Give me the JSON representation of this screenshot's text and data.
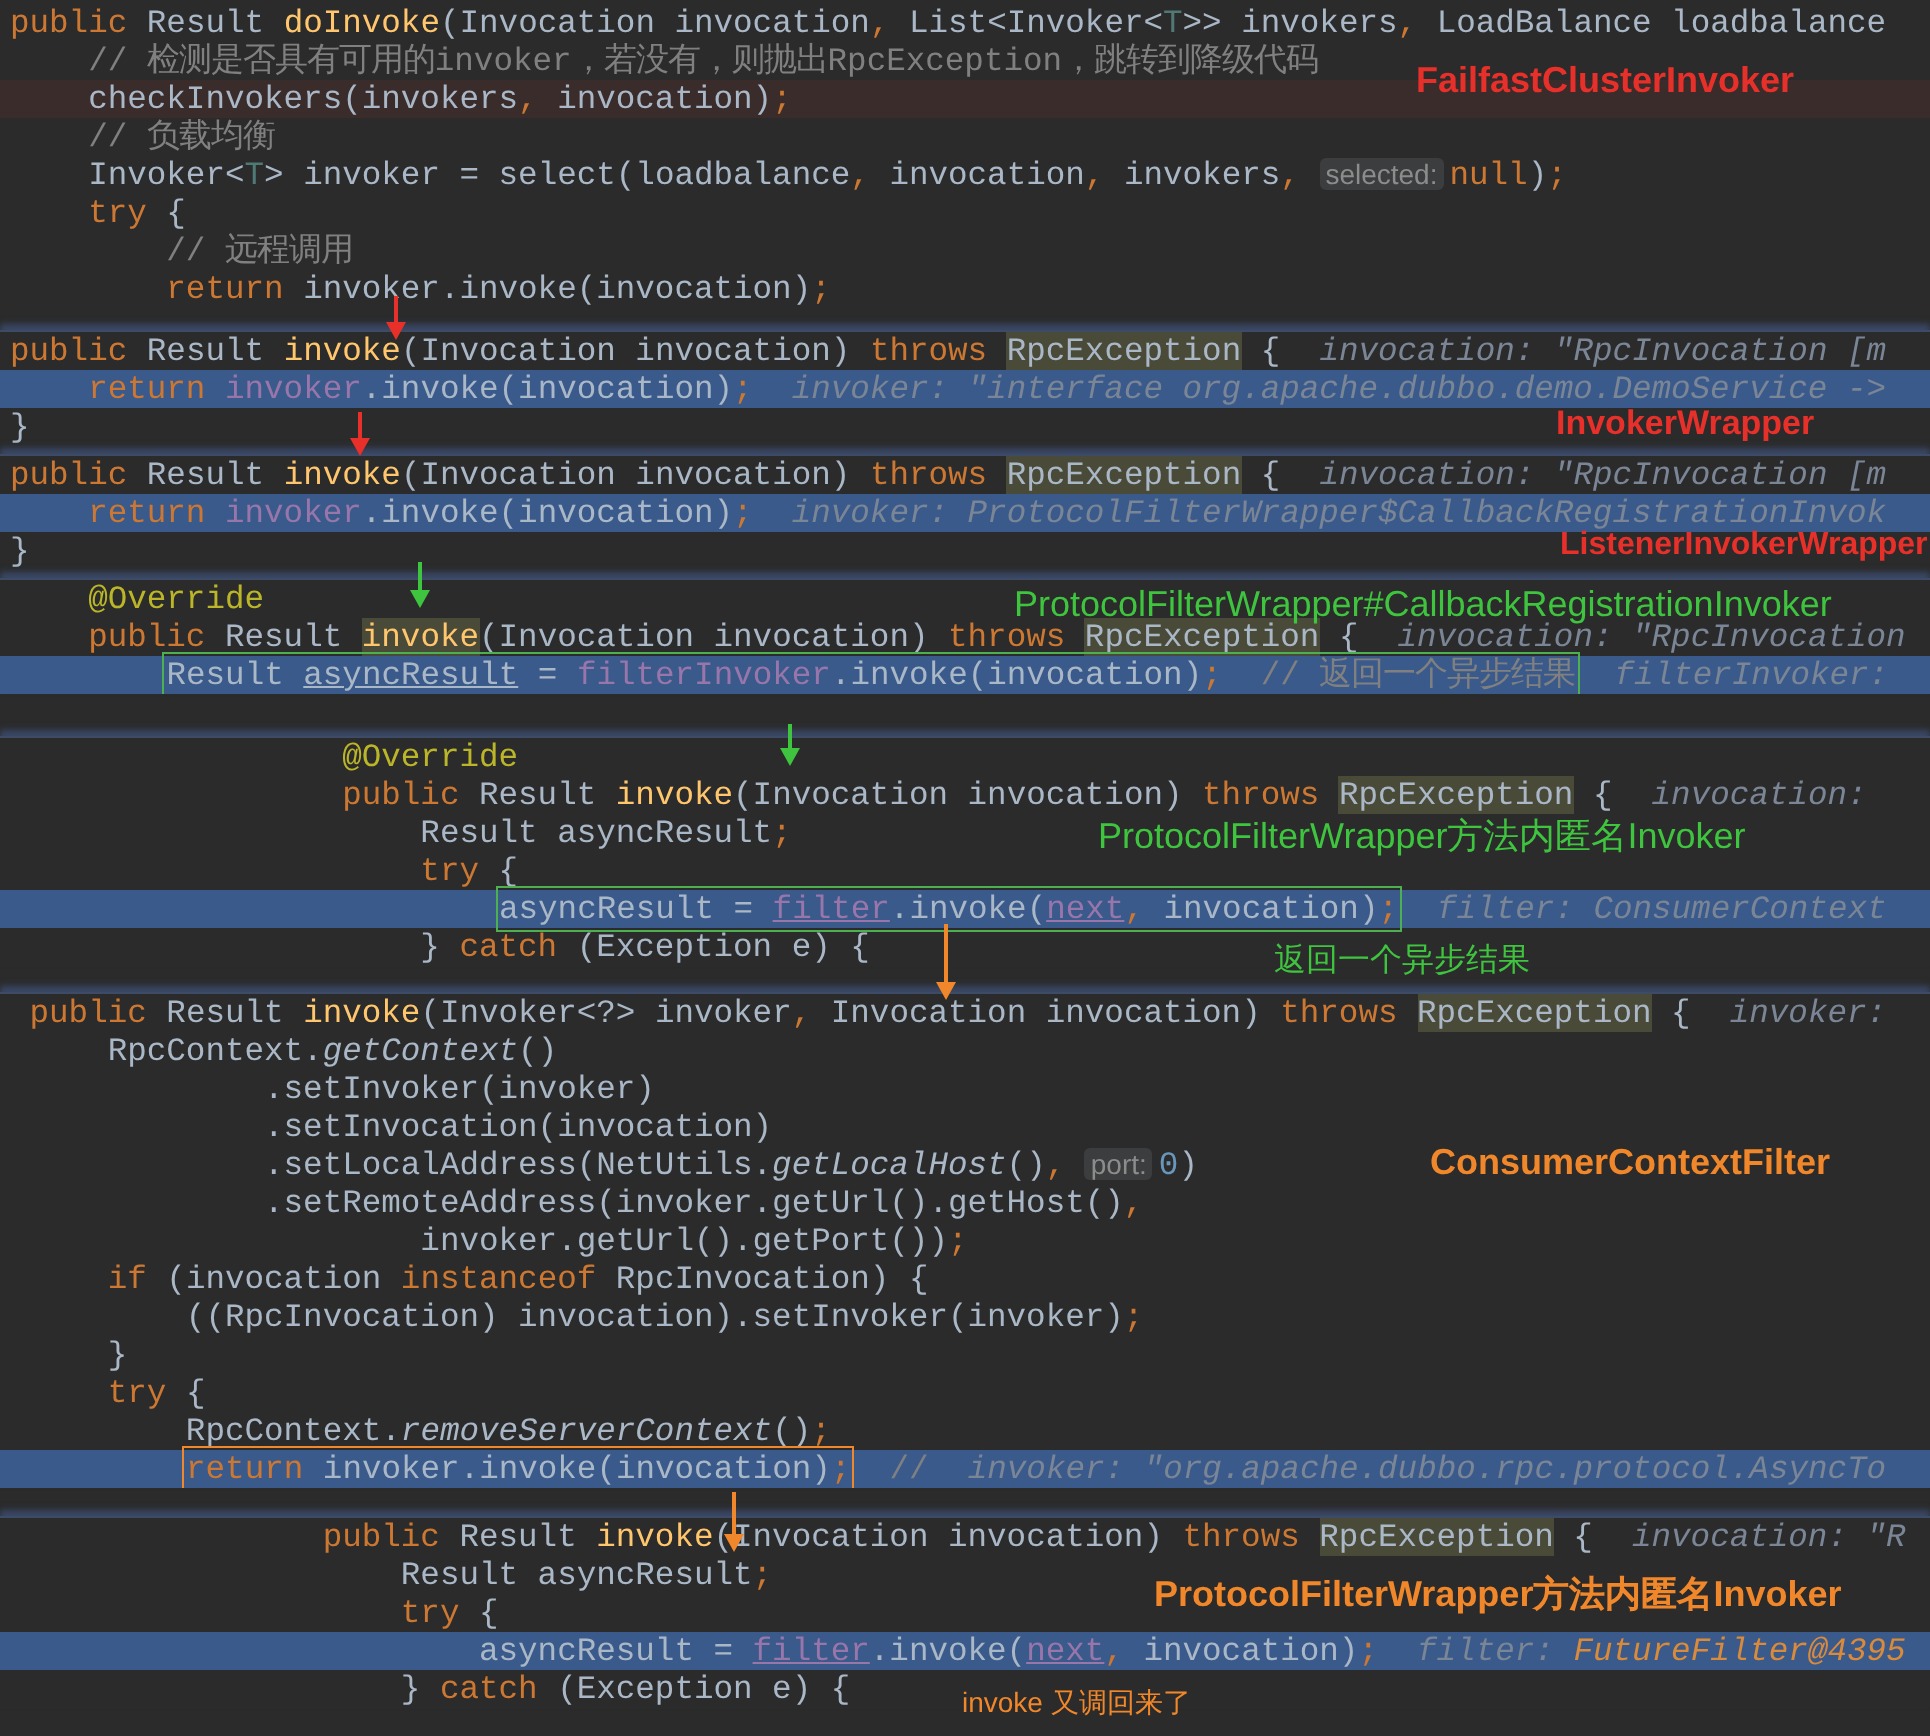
{
  "panels": [
    {
      "lines": [
        {
          "tokens": [
            {
              "kind": "keyword",
              "text": "public "
            },
            {
              "kind": "plain",
              "text": "Result "
            },
            {
              "kind": "method",
              "text": "doInvoke"
            },
            {
              "kind": "plain",
              "text": "(Invocation invocation"
            },
            {
              "kind": "keyword",
              "text": ", "
            },
            {
              "kind": "plain",
              "text": "List<Invoker<"
            },
            {
              "kind": "type",
              "text": "T"
            },
            {
              "kind": "plain",
              "text": ">> invokers"
            },
            {
              "kind": "keyword",
              "text": ", "
            },
            {
              "kind": "plain",
              "text": "LoadBalance loadbalance"
            }
          ]
        },
        {
          "tokens": [
            {
              "kind": "comment",
              "text": "    // 检测是否具有可用的invoker，若没有，则抛出RpcException，跳转到降级代码"
            }
          ]
        },
        {
          "breakpoint": true,
          "tokens": [
            {
              "kind": "plain",
              "text": "    checkInvokers(invokers"
            },
            {
              "kind": "keyword",
              "text": ", "
            },
            {
              "kind": "plain",
              "text": "invocation)"
            },
            {
              "kind": "keyword",
              "text": ";"
            }
          ]
        },
        {
          "tokens": [
            {
              "kind": "comment",
              "text": "    // 负载均衡"
            }
          ]
        },
        {
          "tokens": [
            {
              "kind": "plain",
              "text": "    Invoker<"
            },
            {
              "kind": "type",
              "text": "T"
            },
            {
              "kind": "plain",
              "text": "> invoker = select(loadbalance"
            },
            {
              "kind": "keyword",
              "text": ", "
            },
            {
              "kind": "plain",
              "text": "invocation"
            },
            {
              "kind": "keyword",
              "text": ", "
            },
            {
              "kind": "plain",
              "text": "invokers"
            },
            {
              "kind": "keyword",
              "text": ", "
            },
            {
              "kind": "chip",
              "text": "selected:"
            },
            {
              "kind": "keyword",
              "text": "null"
            },
            {
              "kind": "plain",
              "text": ")"
            },
            {
              "kind": "keyword",
              "text": ";"
            }
          ]
        },
        {
          "tokens": [
            {
              "kind": "keyword",
              "text": "    try "
            },
            {
              "kind": "plain",
              "text": "{"
            }
          ]
        },
        {
          "tokens": [
            {
              "kind": "comment",
              "text": "        // 远程调用"
            }
          ]
        },
        {
          "tokens": [
            {
              "kind": "keyword",
              "text": "        return "
            },
            {
              "kind": "plain",
              "text": "invoker.invoke(invocation)"
            },
            {
              "kind": "keyword",
              "text": ";"
            }
          ]
        }
      ]
    },
    {
      "lines": [
        {
          "tokens": [
            {
              "kind": "keyword",
              "text": "public "
            },
            {
              "kind": "plain",
              "text": "Result "
            },
            {
              "kind": "method",
              "text": "invoke"
            },
            {
              "kind": "plain",
              "text": "(Invocation invocation) "
            },
            {
              "kind": "keyword",
              "text": "throws "
            },
            {
              "kind": "exception",
              "text": "RpcException"
            },
            {
              "kind": "plain",
              "text": " {  "
            },
            {
              "kind": "hint",
              "text": "invocation: \"RpcInvocation [m"
            }
          ]
        },
        {
          "highlighted": true,
          "tokens": [
            {
              "kind": "keyword",
              "text": "    return "
            },
            {
              "kind": "field",
              "text": "invoker"
            },
            {
              "kind": "plain",
              "text": ".invoke(invocation)"
            },
            {
              "kind": "keyword",
              "text": ";"
            },
            {
              "kind": "hint",
              "text": "  invoker: \"interface org.apache.dubbo.demo.DemoService ->"
            }
          ]
        },
        {
          "tokens": [
            {
              "kind": "plain",
              "text": "}"
            }
          ]
        }
      ]
    },
    {
      "lines": [
        {
          "tokens": [
            {
              "kind": "keyword",
              "text": "public "
            },
            {
              "kind": "plain",
              "text": "Result "
            },
            {
              "kind": "method",
              "text": "invoke"
            },
            {
              "kind": "plain",
              "text": "(Invocation invocation) "
            },
            {
              "kind": "keyword",
              "text": "throws "
            },
            {
              "kind": "exception",
              "text": "RpcException"
            },
            {
              "kind": "plain",
              "text": " {  "
            },
            {
              "kind": "hint",
              "text": "invocation: \"RpcInvocation [m"
            }
          ]
        },
        {
          "highlighted": true,
          "tokens": [
            {
              "kind": "keyword",
              "text": "    return "
            },
            {
              "kind": "field",
              "text": "invoker"
            },
            {
              "kind": "plain",
              "text": ".invoke(invocation)"
            },
            {
              "kind": "keyword",
              "text": ";"
            },
            {
              "kind": "hint",
              "text": "  invoker: ProtocolFilterWrapper$CallbackRegistrationInvok"
            }
          ]
        },
        {
          "tokens": [
            {
              "kind": "plain",
              "text": "}"
            }
          ]
        }
      ]
    },
    {
      "lines": [
        {
          "tokens": [
            {
              "kind": "annotation",
              "text": "    @Override"
            }
          ]
        },
        {
          "tokens": [
            {
              "kind": "keyword",
              "text": "    public "
            },
            {
              "kind": "plain",
              "text": "Result "
            },
            {
              "kind": "usage",
              "text": "invoke"
            },
            {
              "kind": "plain",
              "text": "(Invocation invocation) "
            },
            {
              "kind": "keyword",
              "text": "throws "
            },
            {
              "kind": "exception",
              "text": "RpcException"
            },
            {
              "kind": "plain",
              "text": " {  "
            },
            {
              "kind": "hint",
              "text": "invocation: \"RpcInvocation"
            }
          ]
        },
        {
          "highlighted": true,
          "tokens": [
            {
              "kind": "box",
              "color": "#4caf50",
              "tokens": [
                {
                  "kind": "plain",
                  "text": "Result "
                },
                {
                  "kind": "underlined",
                  "text": "asyncResult"
                },
                {
                  "kind": "plain",
                  "text": " = "
                },
                {
                  "kind": "field",
                  "text": "filterInvoker"
                },
                {
                  "kind": "plain",
                  "text": ".invoke(invocation)"
                },
                {
                  "kind": "keyword",
                  "text": ";"
                },
                {
                  "kind": "comment",
                  "text": "  // 返回一个异步结果"
                }
              ]
            },
            {
              "kind": "hint",
              "text": "  filterInvoker:"
            }
          ]
        }
      ]
    },
    {
      "lines": [
        {
          "tokens": [
            {
              "kind": "annotation",
              "text": "                 @Override"
            }
          ]
        },
        {
          "tokens": [
            {
              "kind": "keyword",
              "text": "                 public "
            },
            {
              "kind": "plain",
              "text": "Result "
            },
            {
              "kind": "method",
              "text": "invoke"
            },
            {
              "kind": "plain",
              "text": "(Invocation invocation) "
            },
            {
              "kind": "keyword",
              "text": "throws "
            },
            {
              "kind": "exception",
              "text": "RpcException"
            },
            {
              "kind": "plain",
              "text": " {  "
            },
            {
              "kind": "hint",
              "text": "invocation:"
            }
          ]
        },
        {
          "tokens": [
            {
              "kind": "plain",
              "text": "                     Result asyncResult"
            },
            {
              "kind": "keyword",
              "text": ";"
            }
          ]
        },
        {
          "tokens": [
            {
              "kind": "keyword",
              "text": "                     try "
            },
            {
              "kind": "plain",
              "text": "{"
            }
          ]
        },
        {
          "highlighted": true,
          "tokens": [
            {
              "kind": "box",
              "color": "#4caf50",
              "tokens": [
                {
                  "kind": "plain",
                  "text": "asyncResult = "
                },
                {
                  "kind": "link",
                  "text": "filter"
                },
                {
                  "kind": "plain",
                  "text": ".invoke("
                },
                {
                  "kind": "link",
                  "text": "next"
                },
                {
                  "kind": "keyword",
                  "text": ", "
                },
                {
                  "kind": "plain",
                  "text": "invocation)"
                },
                {
                  "kind": "keyword",
                  "text": ";"
                }
              ]
            },
            {
              "kind": "hint",
              "text": "  filter: ConsumerContext"
            }
          ]
        },
        {
          "tokens": [
            {
              "kind": "plain",
              "text": "                     } "
            },
            {
              "kind": "keyword",
              "text": "catch "
            },
            {
              "kind": "plain",
              "text": "(Exception e) {"
            }
          ]
        }
      ]
    },
    {
      "lines": [
        {
          "tokens": [
            {
              "kind": "keyword",
              "text": " public "
            },
            {
              "kind": "plain",
              "text": "Result "
            },
            {
              "kind": "method",
              "text": "invoke"
            },
            {
              "kind": "plain",
              "text": "(Invoker<?> invoker"
            },
            {
              "kind": "keyword",
              "text": ", "
            },
            {
              "kind": "plain",
              "text": "Invocation invocation) "
            },
            {
              "kind": "keyword",
              "text": "throws "
            },
            {
              "kind": "exception",
              "text": "RpcException"
            },
            {
              "kind": "plain",
              "text": " {  "
            },
            {
              "kind": "hint",
              "text": "invoker:"
            }
          ]
        },
        {
          "tokens": [
            {
              "kind": "plain",
              "text": "     RpcContext."
            },
            {
              "kind": "italic",
              "text": "getContext"
            },
            {
              "kind": "plain",
              "text": "()"
            }
          ]
        },
        {
          "tokens": [
            {
              "kind": "plain",
              "text": "             .setInvoker(invoker)"
            }
          ]
        },
        {
          "tokens": [
            {
              "kind": "plain",
              "text": "             .setInvocation(invocation)"
            }
          ]
        },
        {
          "tokens": [
            {
              "kind": "plain",
              "text": "             .setLocalAddress(NetUtils."
            },
            {
              "kind": "italic",
              "text": "getLocalHost"
            },
            {
              "kind": "plain",
              "text": "()"
            },
            {
              "kind": "keyword",
              "text": ", "
            },
            {
              "kind": "chip",
              "text": "port:"
            },
            {
              "kind": "number",
              "text": "0"
            },
            {
              "kind": "plain",
              "text": ")"
            }
          ]
        },
        {
          "tokens": [
            {
              "kind": "plain",
              "text": "             .setRemoteAddress(invoker.getUrl().getHost()"
            },
            {
              "kind": "keyword",
              "text": ","
            }
          ]
        },
        {
          "tokens": [
            {
              "kind": "plain",
              "text": "                     invoker.getUrl().getPort())"
            },
            {
              "kind": "keyword",
              "text": ";"
            }
          ]
        },
        {
          "tokens": [
            {
              "kind": "keyword",
              "text": "     if "
            },
            {
              "kind": "plain",
              "text": "(invocation "
            },
            {
              "kind": "keyword",
              "text": "instanceof "
            },
            {
              "kind": "plain",
              "text": "RpcInvocation) {"
            }
          ]
        },
        {
          "tokens": [
            {
              "kind": "plain",
              "text": "         ((RpcInvocation) invocation).setInvoker(invoker)"
            },
            {
              "kind": "keyword",
              "text": ";"
            }
          ]
        },
        {
          "tokens": [
            {
              "kind": "plain",
              "text": "     }"
            }
          ]
        },
        {
          "tokens": [
            {
              "kind": "keyword",
              "text": "     try "
            },
            {
              "kind": "plain",
              "text": "{"
            }
          ]
        },
        {
          "tokens": [
            {
              "kind": "plain",
              "text": "         RpcContext."
            },
            {
              "kind": "italic",
              "text": "removeServerContext"
            },
            {
              "kind": "plain",
              "text": "()"
            },
            {
              "kind": "keyword",
              "text": ";"
            }
          ]
        },
        {
          "highlighted": true,
          "tokens": [
            {
              "kind": "box",
              "color": "#f0872a",
              "tokens": [
                {
                  "kind": "keyword",
                  "text": "return "
                },
                {
                  "kind": "plain",
                  "text": "invoker.invoke(invocation)"
                },
                {
                  "kind": "keyword",
                  "text": ";"
                }
              ]
            },
            {
              "kind": "comment",
              "text": "  //  "
            },
            {
              "kind": "hint",
              "text": "invoker: \"org.apache.dubbo.rpc.protocol.AsyncTo"
            }
          ]
        }
      ]
    },
    {
      "lines": [
        {
          "tokens": [
            {
              "kind": "keyword",
              "text": "                public "
            },
            {
              "kind": "plain",
              "text": "Result "
            },
            {
              "kind": "method",
              "text": "invoke"
            },
            {
              "kind": "plain",
              "text": "(Invocation invocation) "
            },
            {
              "kind": "keyword",
              "text": "throws "
            },
            {
              "kind": "exception",
              "text": "RpcException"
            },
            {
              "kind": "plain",
              "text": " {  "
            },
            {
              "kind": "hint",
              "text": "invocation: \"R"
            }
          ]
        },
        {
          "tokens": [
            {
              "kind": "plain",
              "text": "                    Result asyncResult"
            },
            {
              "kind": "keyword",
              "text": ";"
            }
          ]
        },
        {
          "tokens": [
            {
              "kind": "keyword",
              "text": "                    try "
            },
            {
              "kind": "plain",
              "text": "{"
            }
          ]
        },
        {
          "highlighted": true,
          "tokens": [
            {
              "kind": "plain",
              "text": "                        asyncResult = "
            },
            {
              "kind": "link",
              "text": "filter"
            },
            {
              "kind": "plain",
              "text": ".invoke("
            },
            {
              "kind": "link",
              "text": "next"
            },
            {
              "kind": "keyword",
              "text": ", "
            },
            {
              "kind": "plain",
              "text": "invocation)"
            },
            {
              "kind": "keyword",
              "text": ";"
            },
            {
              "kind": "hint",
              "text": "  filter: "
            },
            {
              "kind": "hint_value",
              "text": "FutureFilter@4395"
            }
          ]
        },
        {
          "tokens": [
            {
              "kind": "plain",
              "text": "                    } "
            },
            {
              "kind": "keyword",
              "text": "catch "
            },
            {
              "kind": "plain",
              "text": "(Exception e) {"
            }
          ]
        }
      ]
    }
  ],
  "annotations": [
    {
      "text": "FailfastClusterInvoker",
      "color": "#e8302a"
    },
    {
      "text": "InvokerWrapper",
      "color": "#e8302a"
    },
    {
      "text": "ListenerInvokerWrapper",
      "color": "#e8302a"
    },
    {
      "text": "ProtocolFilterWrapper#CallbackRegistrationInvoker",
      "color": "#3ec43e"
    },
    {
      "text": "ProtocolFilterWrapper方法内匿名Invoker",
      "color": "#3ec43e"
    },
    {
      "text": "返回一个异步结果",
      "color": "#3ec43e"
    },
    {
      "text": "ConsumerContextFilter",
      "color": "#f0872a"
    },
    {
      "text": "ProtocolFilterWrapper方法内匿名Invoker",
      "color": "#f0872a"
    },
    {
      "text": "invoke 又调回来了",
      "color": "#f0872a"
    }
  ]
}
